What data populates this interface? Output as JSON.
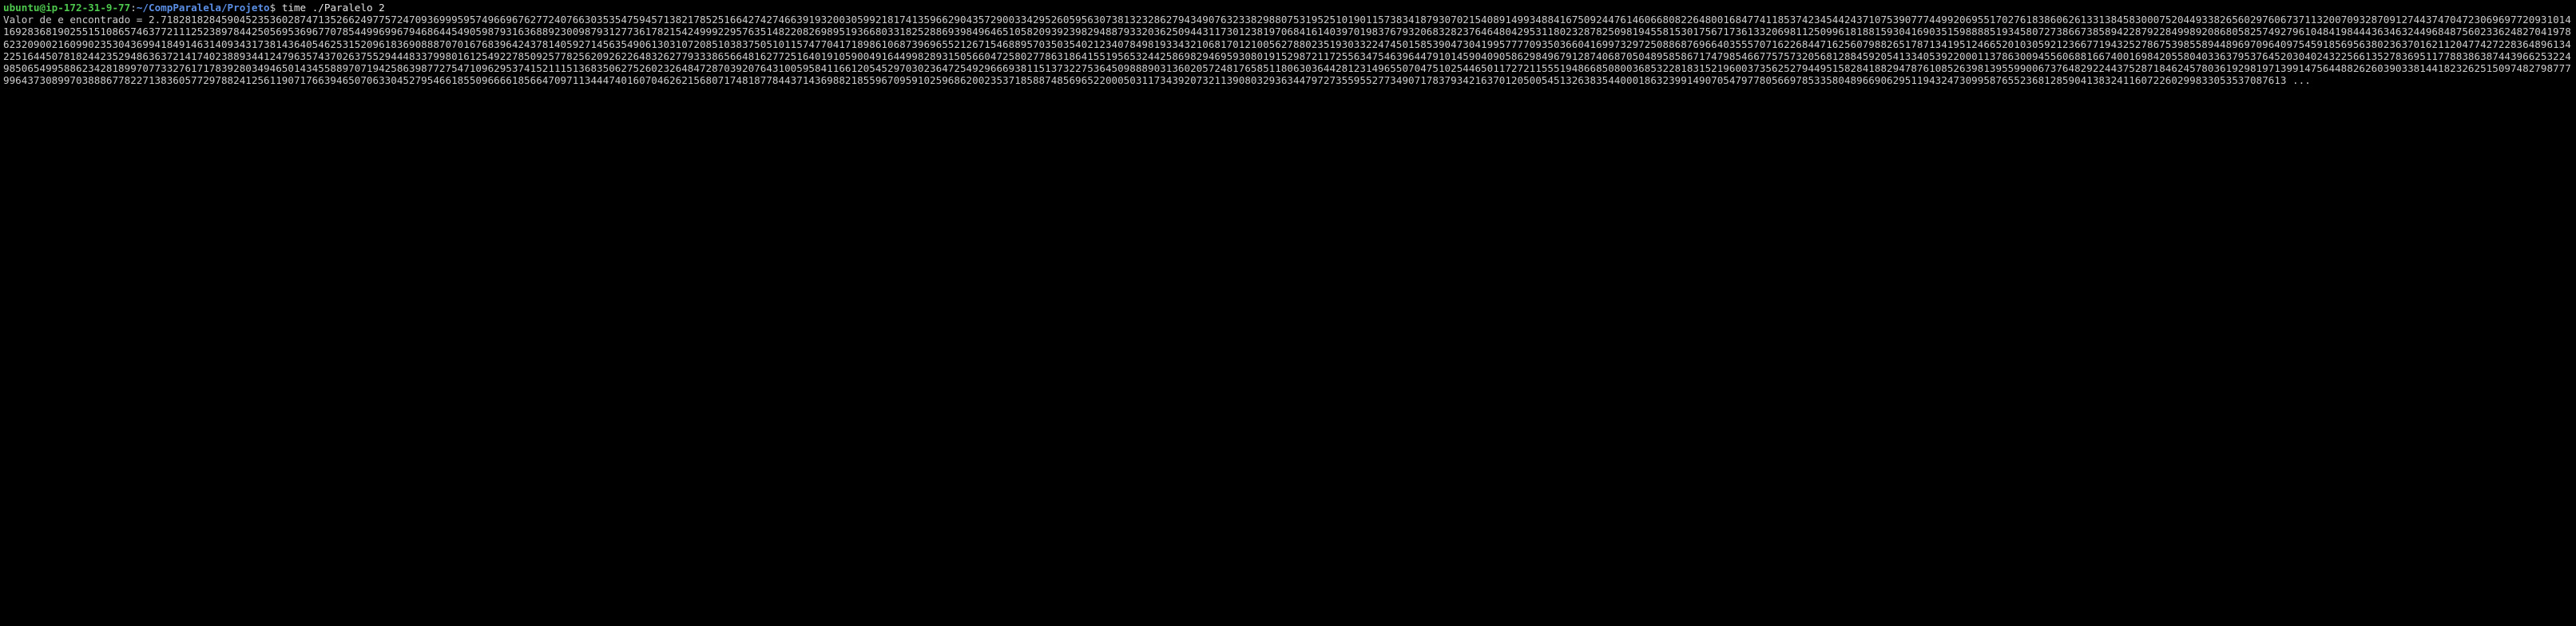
{
  "terminal": {
    "prompt": {
      "user_host": "ubuntu@ip-172-31-9-77",
      "colon": ":",
      "path": "~/CompParalela/Projeto",
      "symbol": "$ ",
      "command": "time ./Paralelo 2"
    },
    "output_label": "Valor de e encontrado = ",
    "output_value": "2.71828182845904523536028747135266249775724709369995957496696762772407663035354759457138217852516642742746639193200305992181741359662904357290033429526059563073813232862794349076323382988075319525101901157383418793070215408914993488416750924476146066808226480016847741185374234544243710753907774499206955170276183860626133138458300075204493382656029760673711320070932870912744374704723069697720931014169283681902551510865746377211125238978442505695369677078544996996794686445490598793163688923009879312773617821542499922957635148220826989519366803318252886939849646510582093923982948879332036250944311730123819706841614039701983767932068328237646480429531180232878250981945581530175671736133206981125099618188159304169035159888851934580727386673858942287922849989208680582574927961048419844436346324496848756023362482704197862320900216099023530436994184914631409343173814364054625315209618369088870701676839642437814059271456354906130310720851038375051011574770417189861068739696552126715468895703503540212340784981933432106817012100562788023519303322474501585390473041995777709350366041699732972508868769664035557071622684471625607988265178713419512466520103059212366771943252786753985589448969709640975459185695638023637016211204774272283648961342251644507818244235294863637214174023889344124796357437026375529444833799801612549227850925778256209262264832627793338656648162772516401910590049164499828931505660472580277863186415519565324425869829469593080191529872117255634754639644791014590409058629849679128740687050489585867174798546677575732056812884592054133405392200011378630094556068816674001698420558040336379537645203040243225661352783695117788386387443966253224985065499588623428189970773327617178392803494650143455889707194258639877275471096295374152111513683506275260232648472870392076431005958411661205452970302364725492966693811513732275364509888903136020572481765851180630364428123149655070475102544650117272115551948668508003685322818315219600373562527944951582841882947876108526398139559900673764829224437528718462457803619298197139914756448826260390338144182326251509748279877799643730899703888677822713836057729788241256119071766394650706330452795466185509666618566470971134447401607046262156807174818778443714369882185596709591025968620023537185887485696522000503117343920732113908032936344797273559552773490717837934216370120500545132638354400018632399149070547977805669785335804896690629511943247309958765523681285904138324116072260299833053537087613 ..."
  }
}
